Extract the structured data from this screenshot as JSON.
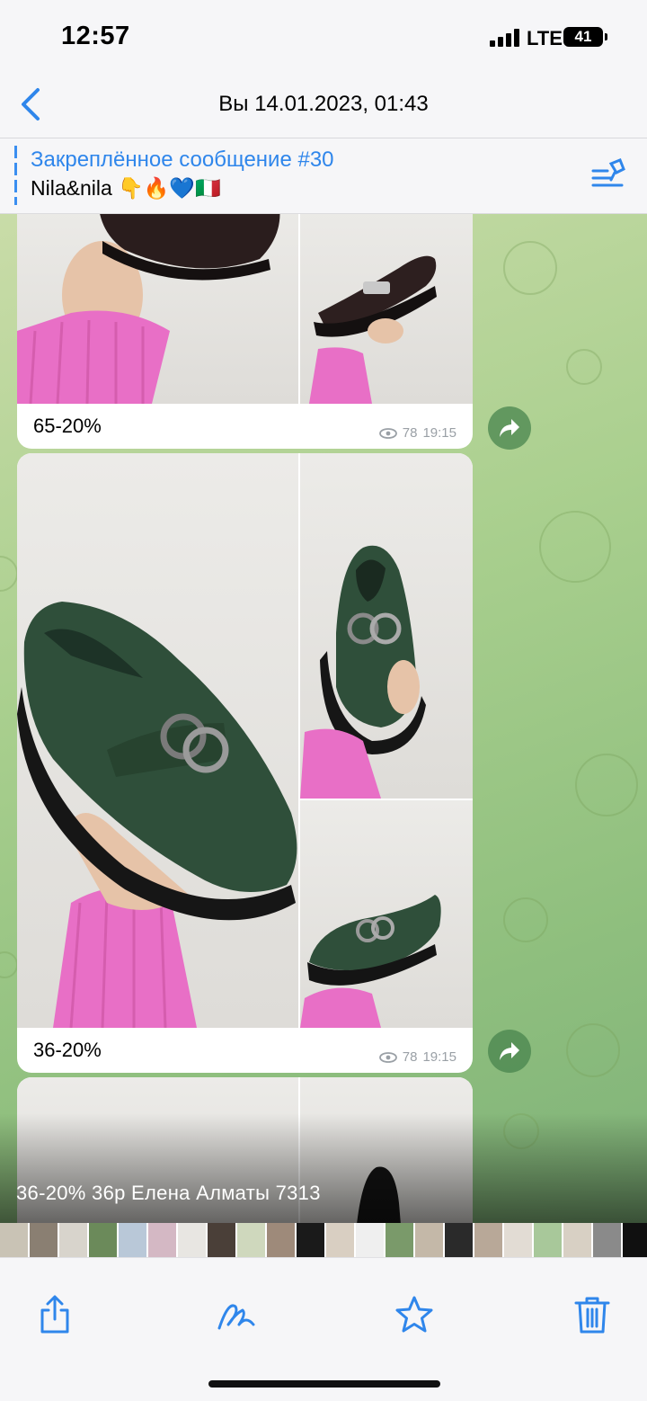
{
  "status_bar": {
    "time": "12:57",
    "network": "LTE",
    "battery": "41"
  },
  "nav": {
    "title": "Вы 14.01.2023, 01:43",
    "back_icon": "chevron-left-icon"
  },
  "pinned": {
    "title": "Закреплённое сообщение #30",
    "text": "Nila&nila 👇🔥💙🇮🇹",
    "icon": "pin-list-icon"
  },
  "messages": [
    {
      "caption": "65-20%",
      "views": "78",
      "time": "19:15"
    },
    {
      "caption": "36-20%",
      "views": "78",
      "time": "19:15"
    }
  ],
  "overlay_caption": "36-20% 36р Елена Алматы 7313",
  "thumbnails": [
    "#c9c3b5",
    "#8a7f72",
    "#d8d4cc",
    "#6b8a5a",
    "#b9c8d8",
    "#d4b8c4",
    "#e8e6e2",
    "#4a3f38",
    "#cfd8bd",
    "#9e8a7a",
    "#1a1a1a",
    "#d9cfc2",
    "#efefef",
    "#7a9a6a",
    "#c4b8a8",
    "#2a2a2a",
    "#b8a898",
    "#e2dcd4",
    "#a8c89a",
    "#d8d0c4",
    "#8a8a8a",
    "#101010",
    "#c8c0b4",
    "#5a7a8a",
    "#d4c8bc",
    "#e8e8e8",
    "#9ab88a",
    "#c4c4c4",
    "#3a3a3a",
    "#b0a090",
    "#dcd4c8",
    "#707070",
    "#e4ded6",
    "#a0b890",
    "#c8bcae",
    "#505050",
    "#d0c8bc",
    "#8aa07a",
    "#ccc4b8",
    "#606060",
    "#e0dad2",
    "#98a888",
    "#444444",
    "#bcb0a4",
    "#d8d0c6",
    "#4a6a3a",
    "#c0b8ac",
    "#808080",
    "#e6e0d8",
    "#5a5a5a"
  ],
  "toolbar": {
    "share": "share-icon",
    "markup": "markup-icon",
    "favorite": "star-icon",
    "delete": "trash-icon"
  },
  "colors": {
    "accent": "#2f86eb",
    "shoe_green": "#2f4f3a",
    "sweater_pink": "#e86fc6"
  }
}
